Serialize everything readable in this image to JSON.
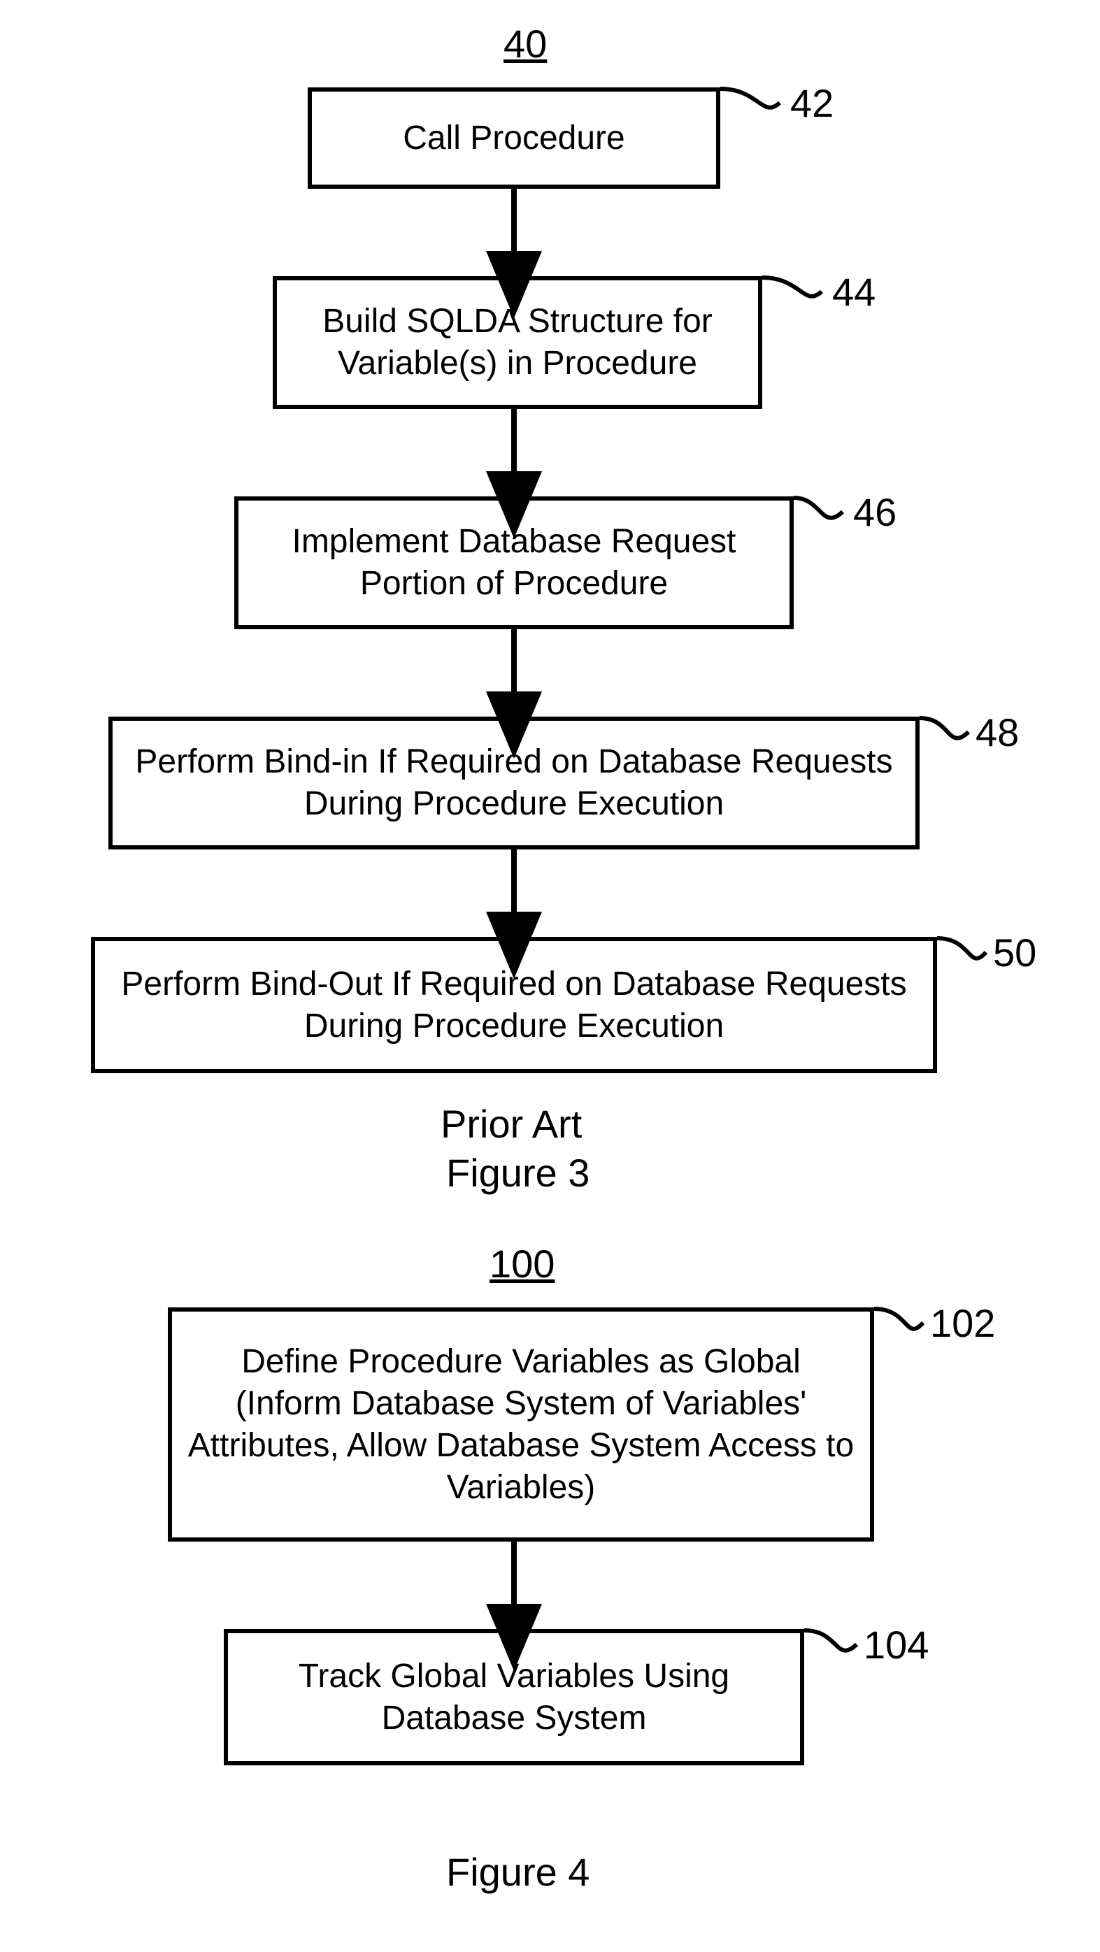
{
  "fig3": {
    "title": "40",
    "boxes": {
      "b42": {
        "text": "Call Procedure",
        "label": "42"
      },
      "b44": {
        "text": "Build SQLDA Structure for Variable(s) in Procedure",
        "label": "44"
      },
      "b46": {
        "text": "Implement Database Request Portion of Procedure",
        "label": "46"
      },
      "b48": {
        "text": "Perform Bind-in If Required on Database Requests During Procedure Execution",
        "label": "48"
      },
      "b50": {
        "text": "Perform Bind-Out If Required on Database Requests During Procedure Execution",
        "label": "50"
      }
    },
    "caption_line1": "Prior Art",
    "caption_line2": "Figure 3"
  },
  "fig4": {
    "title": "100",
    "boxes": {
      "b102": {
        "text": "Define Procedure Variables as Global (Inform Database System of Variables' Attributes, Allow Database System Access to Variables)",
        "label": "102"
      },
      "b104": {
        "text": "Track Global Variables Using Database System",
        "label": "104"
      }
    },
    "caption": "Figure 4"
  }
}
